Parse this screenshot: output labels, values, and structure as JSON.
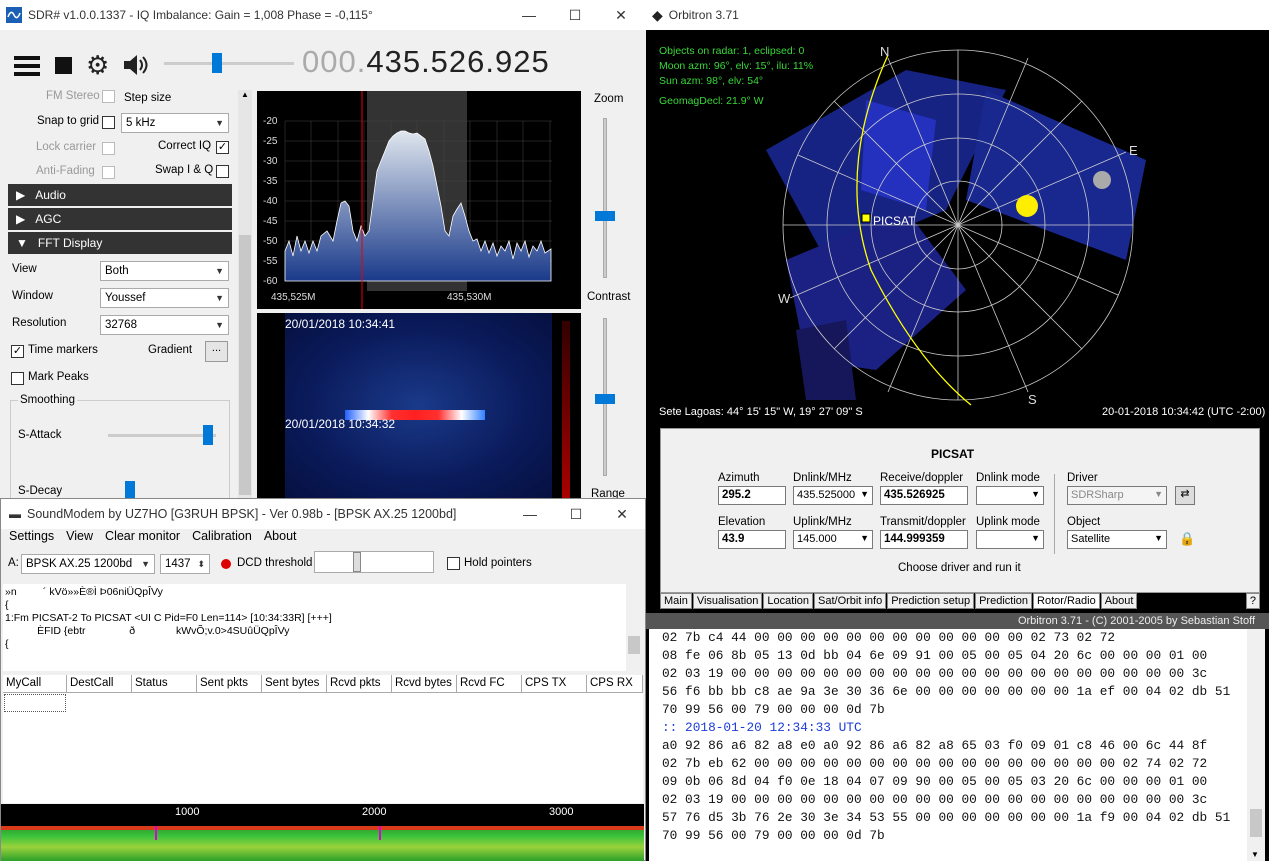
{
  "sdr": {
    "title": "SDR# v1.0.0.1337 - IQ Imbalance: Gain = 1,008 Phase = -0,115°",
    "freq_dim": "000.",
    "freq_main": "435.526.925",
    "fm_stereo": "FM Stereo",
    "step_size": "Step size",
    "snap_to_grid": "Snap to grid",
    "step_value": "5 kHz",
    "lock_carrier": "Lock carrier",
    "correct_iq": "Correct IQ",
    "anti_fading": "Anti-Fading",
    "swap_iq": "Swap I & Q",
    "sections": [
      "Audio",
      "AGC",
      "FFT Display"
    ],
    "view_label": "View",
    "view_value": "Both",
    "window_label": "Window",
    "window_value": "Youssef",
    "resolution_label": "Resolution",
    "resolution_value": "32768",
    "time_markers": "Time markers",
    "gradient": "Gradient",
    "gradient_btn": "...",
    "mark_peaks": "Mark Peaks",
    "smoothing": "Smoothing",
    "s_attack": "S-Attack",
    "s_decay": "S-Decay",
    "zoom": "Zoom",
    "contrast": "Contrast",
    "range": "Range",
    "spectrum_yticks": [
      "-20",
      "-25",
      "-30",
      "-35",
      "-40",
      "-45",
      "-50",
      "-55",
      "-60"
    ],
    "spectrum_xticks": [
      "435,525M",
      "435,530M"
    ],
    "waterfall_ts1": "20/01/2018 10:34:41",
    "waterfall_ts2": "20/01/2018 10:34:32"
  },
  "orbitron": {
    "title": "Orbitron 3.71",
    "info": [
      "Objects on radar: 1, eclipsed: 0",
      "Moon azm: 96°, elv: 15°, ilu: 11%",
      "Sun azm: 98°, elv: 54°"
    ],
    "geomag": "GeomagDecl: 21.9° W",
    "compass": {
      "n": "N",
      "e": "E",
      "s": "S",
      "w": "W"
    },
    "sat_label": "PICSAT",
    "location": "Sete Lagoas: 44° 15' 15\" W, 19° 27' 09\" S",
    "datetime": "20-01-2018 10:34:42 (UTC -2:00)",
    "panel_title": "PICSAT",
    "azimuth_label": "Azimuth",
    "azimuth": "295.2",
    "dnlink_label": "Dnlink/MHz",
    "dnlink": "435.525000",
    "receive_label": "Receive/doppler",
    "receive": "435.526925",
    "dnmode_label": "Dnlink mode",
    "driver_label": "Driver",
    "driver": "SDRSharp",
    "elevation_label": "Elevation",
    "elevation": "43.9",
    "uplink_label": "Uplink/MHz",
    "uplink": "145.000",
    "transmit_label": "Transmit/doppler",
    "transmit": "144.999359",
    "upmode_label": "Uplink mode",
    "object_label": "Object",
    "object": "Satellite",
    "hint": "Choose driver and run it",
    "tabs": [
      "Main",
      "Visualisation",
      "Location",
      "Sat/Orbit info",
      "Prediction setup",
      "Prediction",
      "Rotor/Radio",
      "About"
    ],
    "help": "?",
    "copyright": "Orbitron 3.71 - (C) 2001-2005 by Sebastian Stoff",
    "hex_lines": [
      "02 7b c4 44 00 00 00 00 00 00 00 00 00 00 00 00 02 73 02 72",
      "08 fe 06 8b 05 13 0d bb 04 6e 09 91 00 05 00 05 04 20 6c 00 00 00 01 00",
      "02 03 19 00 00 00 00 00 00 00 00 00 00 00 00 00 00 00 00 00 00 00 00 3c",
      "56 f6 bb bb c8 ae 9a 3e 30 36 6e 00 00 00 00 00 00 00 1a ef 00 04 02 db 51",
      "70 99 56 00 79 00 00 00 0d 7b",
      ":: 2018-01-20 12:34:33 UTC",
      "a0 92 86 a6 82 a8 e0 a0 92 86 a6 82 a8 65 03 f0 09 01 c8 46 00 6c 44 8f",
      "02 7b eb 62 00 00 00 00 00 00 00 00 00 00 00 00 00 00 00 00 02 74 02 72",
      "09 0b 06 8d 04 f0 0e 18 04 07 09 90 00 05 00 05 03 20 6c 00 00 00 01 00",
      "02 03 19 00 00 00 00 00 00 00 00 00 00 00 00 00 00 00 00 00 00 00 00 3c",
      "57 76 d5 3b 76 2e 30 3e 34 53 55 00 00 00 00 00 00 00 1a f9 00 04 02 db 51",
      "70 99 56 00 79 00 00 00 0d 7b"
    ]
  },
  "soundmodem": {
    "title": "SoundModem by UZ7HO [G3RUH BPSK] - Ver 0.98b - [BPSK AX.25 1200bd]",
    "menu": [
      "Settings",
      "View",
      "Clear monitor",
      "Calibration",
      "About"
    ],
    "channel_label": "A:",
    "mode": "BPSK AX.25 1200bd",
    "freq": "1437",
    "dcd": "DCD threshold",
    "hold": "Hold pointers",
    "monitor_lines": [
      "»n         ´ kVö»»È®Ì Þ06niÜQpÎVy",
      "{",
      "1:Fm PICSAT-2 To PICSAT <UI C Pid=F0 Len=114> [10:34:33R] [+++]",
      "           ÈFID {ebtr               ð              kWvÕ;v.0>4SUûÜQpÎVy",
      "{"
    ],
    "columns": [
      "MyCall",
      "DestCall",
      "Status",
      "Sent pkts",
      "Sent bytes",
      "Rcvd pkts",
      "Rcvd bytes",
      "Rcvd FC",
      "CPS TX",
      "CPS RX"
    ],
    "wf_ticks": [
      "1000",
      "2000",
      "3000"
    ]
  }
}
